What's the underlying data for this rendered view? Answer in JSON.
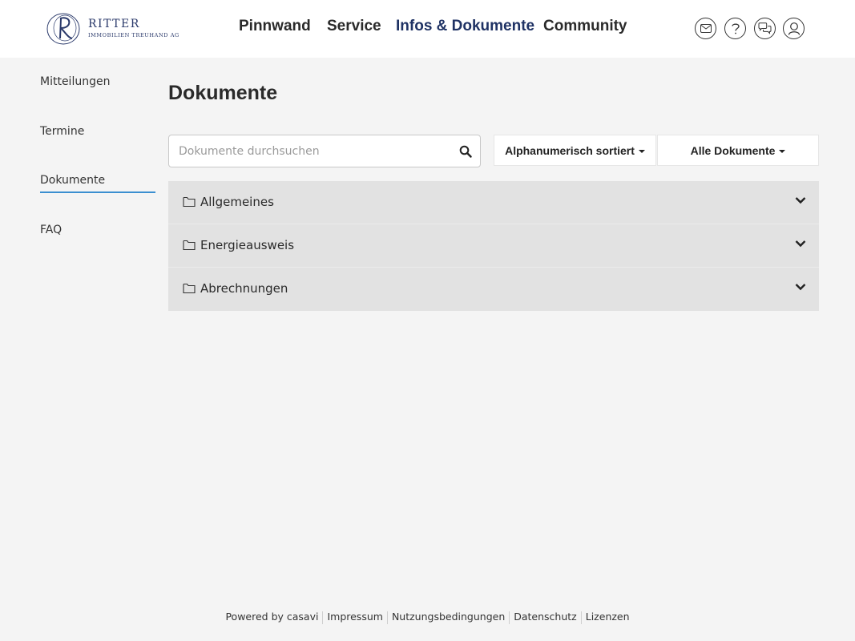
{
  "brand": {
    "title": "RITTER",
    "subtitle": "IMMOBILIEN TREUHAND AG",
    "color": "#2b3a6b"
  },
  "nav": {
    "items": [
      {
        "label": "Pinnwand"
      },
      {
        "label": "Service"
      },
      {
        "label": "Infos & Dokumente",
        "active": true
      },
      {
        "label": "Community"
      }
    ],
    "active_color": "#1f3264"
  },
  "header_icons": [
    "mail-icon",
    "help-icon",
    "chat-icon",
    "user-icon"
  ],
  "sidebar": {
    "items": [
      {
        "label": "Mitteilungen"
      },
      {
        "label": "Termine"
      },
      {
        "label": "Dokumente",
        "active": true
      },
      {
        "label": "FAQ"
      }
    ],
    "active_color": "#3a8fd0"
  },
  "main": {
    "title": "Dokumente",
    "search": {
      "placeholder": "Dokumente durchsuchen",
      "value": ""
    },
    "sort_dropdown": {
      "label": "Alphanumerisch sortiert"
    },
    "filter_dropdown": {
      "label": "Alle Dokumente"
    },
    "folders": [
      {
        "label": "Allgemeines"
      },
      {
        "label": "Energieausweis"
      },
      {
        "label": "Abrechnungen"
      }
    ]
  },
  "footer": {
    "powered": "Powered by casavi",
    "links": [
      "Impressum",
      "Nutzungsbedingungen",
      "Datenschutz",
      "Lizenzen"
    ]
  }
}
